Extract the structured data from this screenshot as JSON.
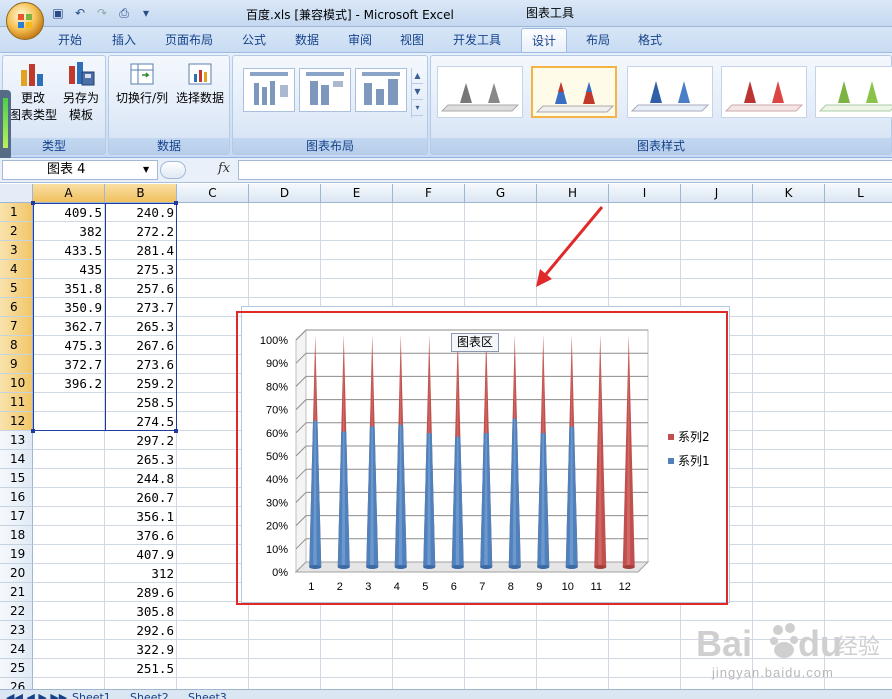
{
  "window": {
    "title": "百度.xls  [兼容模式] - Microsoft Excel",
    "context_tools_label": "图表工具"
  },
  "tabs": [
    "开始",
    "插入",
    "页面布局",
    "公式",
    "数据",
    "审阅",
    "视图",
    "开发工具",
    "设计",
    "布局",
    "格式"
  ],
  "active_tab": "设计",
  "ribbon": {
    "type_group": {
      "label": "类型",
      "change_type": "更改\n图表类型",
      "save_template": "另存为\n模板"
    },
    "data_group": {
      "label": "数据",
      "switch_row_col": "切换行/列",
      "select_data": "选择数据"
    },
    "layout_group": {
      "label": "图表布局"
    },
    "styles_group": {
      "label": "图表样式"
    }
  },
  "formula_bar": {
    "name_box": "图表 4",
    "fx_label": "fx",
    "formula": ""
  },
  "sheet": {
    "columns": [
      "A",
      "B",
      "C",
      "D",
      "E",
      "F",
      "G",
      "H",
      "I",
      "J",
      "K",
      "L"
    ],
    "rows": [
      "1",
      "2",
      "3",
      "4",
      "5",
      "6",
      "7",
      "8",
      "9",
      "10",
      "11",
      "12",
      "13",
      "14",
      "15",
      "16",
      "17",
      "18",
      "19",
      "20",
      "21",
      "22",
      "23",
      "24",
      "25",
      "26"
    ],
    "col_a": [
      "409.5",
      "382",
      "433.5",
      "435",
      "351.8",
      "350.9",
      "362.7",
      "475.3",
      "372.7",
      "396.2",
      "",
      "",
      "",
      "",
      "",
      "",
      "",
      "",
      "",
      "",
      "",
      "",
      "",
      "",
      "",
      ""
    ],
    "col_b": [
      "240.9",
      "272.2",
      "281.4",
      "275.3",
      "257.6",
      "273.7",
      "265.3",
      "267.6",
      "273.6",
      "259.2",
      "258.5",
      "274.5",
      "297.2",
      "265.3",
      "244.8",
      "260.7",
      "356.1",
      "376.6",
      "407.9",
      "312",
      "289.6",
      "305.8",
      "292.6",
      "322.9",
      "251.5",
      ""
    ]
  },
  "chart_data": {
    "type": "bar",
    "subtype": "100% stacked cone",
    "categories": [
      "1",
      "2",
      "3",
      "4",
      "5",
      "6",
      "7",
      "8",
      "9",
      "10",
      "11",
      "12"
    ],
    "series": [
      {
        "name": "系列1",
        "color": "#4f81bd",
        "values": [
          409.5,
          382,
          433.5,
          435,
          351.8,
          350.9,
          362.7,
          475.3,
          372.7,
          396.2,
          0,
          0
        ]
      },
      {
        "name": "系列2",
        "color": "#c0504d",
        "values": [
          240.9,
          272.2,
          281.4,
          275.3,
          257.6,
          273.7,
          265.3,
          267.6,
          273.6,
          259.2,
          258.5,
          274.5
        ]
      }
    ],
    "y_ticks": [
      "0%",
      "10%",
      "20%",
      "30%",
      "40%",
      "50%",
      "60%",
      "70%",
      "80%",
      "90%",
      "100%"
    ],
    "ylim": [
      0,
      100
    ],
    "grid": true,
    "legend": {
      "position": "right",
      "entries": [
        "系列2",
        "系列1"
      ]
    },
    "tooltip": "图表区"
  },
  "sheet_tabs": [
    "Sheet1",
    "Sheet2",
    "Sheet3"
  ],
  "watermark": {
    "text": "Baidu经验",
    "sub": "jingyan.baidu.com"
  }
}
